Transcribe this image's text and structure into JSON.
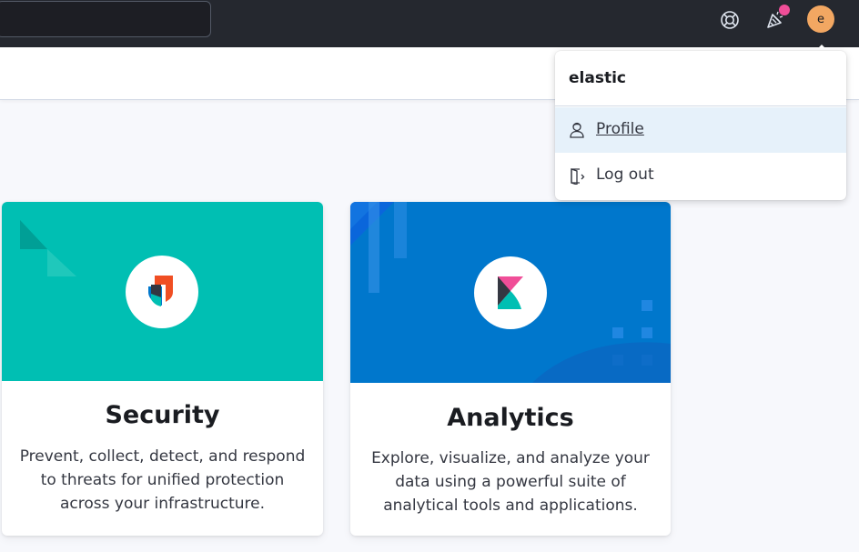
{
  "header": {
    "help_icon": "help-lifebuoy-icon",
    "news_icon": "newsfeed-icon",
    "news_badge_color": "#f04e98",
    "avatar_initial": "e",
    "avatar_color": "#f2a762"
  },
  "user_menu": {
    "username": "elastic",
    "items": [
      {
        "label": "Profile",
        "icon": "user-icon",
        "highlighted": true
      },
      {
        "label": "Log out",
        "icon": "exit-icon",
        "highlighted": false
      }
    ]
  },
  "cards": [
    {
      "title": "Security",
      "description": "Prevent, collect, detect, and respond to threats for unified protection across your infrastructure.",
      "banner_color": "#00bfb3",
      "logo": "elastic-security-logo-icon"
    },
    {
      "title": "Analytics",
      "description": "Explore, visualize, and analyze your data using a powerful suite of analytical tools and applications.",
      "banner_color": "#0077cc",
      "logo": "kibana-logo-icon"
    }
  ]
}
